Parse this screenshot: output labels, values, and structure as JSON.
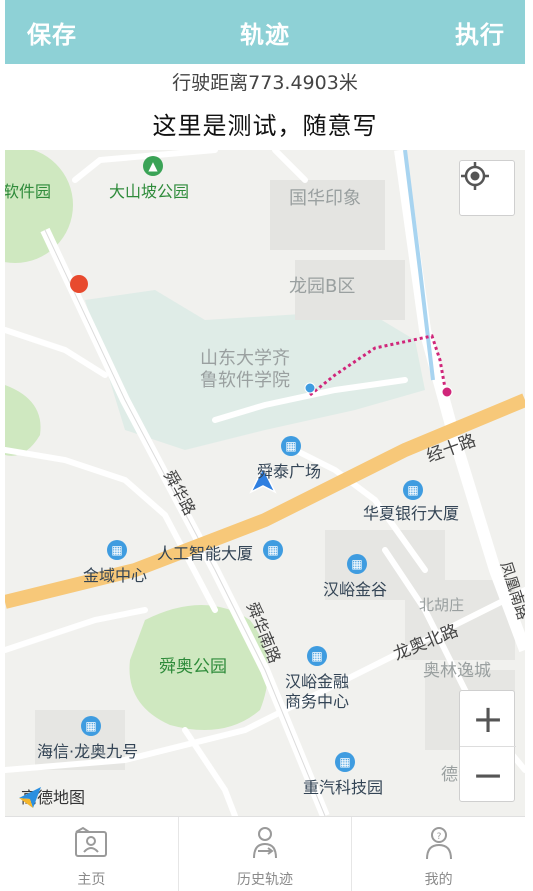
{
  "header": {
    "save_label": "保存",
    "title": "轨迹",
    "run_label": "执行"
  },
  "info": {
    "distance_text": "行驶距离773.4903米",
    "note_text": "这里是测试，随意写"
  },
  "map": {
    "labels": {
      "ruanjianyuan": "软件园",
      "dashanpo": "大山坡公园",
      "guohua": "国华印象",
      "longyuan": "龙园B区",
      "sdu": "山东大学齐",
      "sdu2": "鲁软件学院",
      "shuntai": "舜泰广场",
      "jingshi": "经十路",
      "huaxia": "华夏银行大厦",
      "shunhua": "舜华路",
      "ai": "人工智能大厦",
      "jinyu": "金域中心",
      "hanyu": "汉峪金谷",
      "beihu": "北胡庄",
      "fengming": "凤凰南路",
      "longao": "龙奥北路",
      "aolin": "奥林逸城",
      "shunao": "舜奥公园",
      "shunhua_s": "舜华南路",
      "hanyu_fin": "汉峪金融",
      "hanyu_fin2": "商务中心",
      "haixin": "海信·龙奥九号",
      "zhongqi": "重汽科技园",
      "derun": "德润天鑫"
    },
    "logo": "高德地图",
    "zoom_in": "+",
    "zoom_out": "−"
  },
  "tabs": [
    {
      "label": "主页",
      "icon": "home-icon"
    },
    {
      "label": "历史轨迹",
      "icon": "history-track-icon"
    },
    {
      "label": "我的",
      "icon": "profile-icon"
    }
  ],
  "colors": {
    "header": "#8ed1d6",
    "track": "#d0267a",
    "main_road": "#f7c879",
    "green": "#cfe8c0"
  }
}
